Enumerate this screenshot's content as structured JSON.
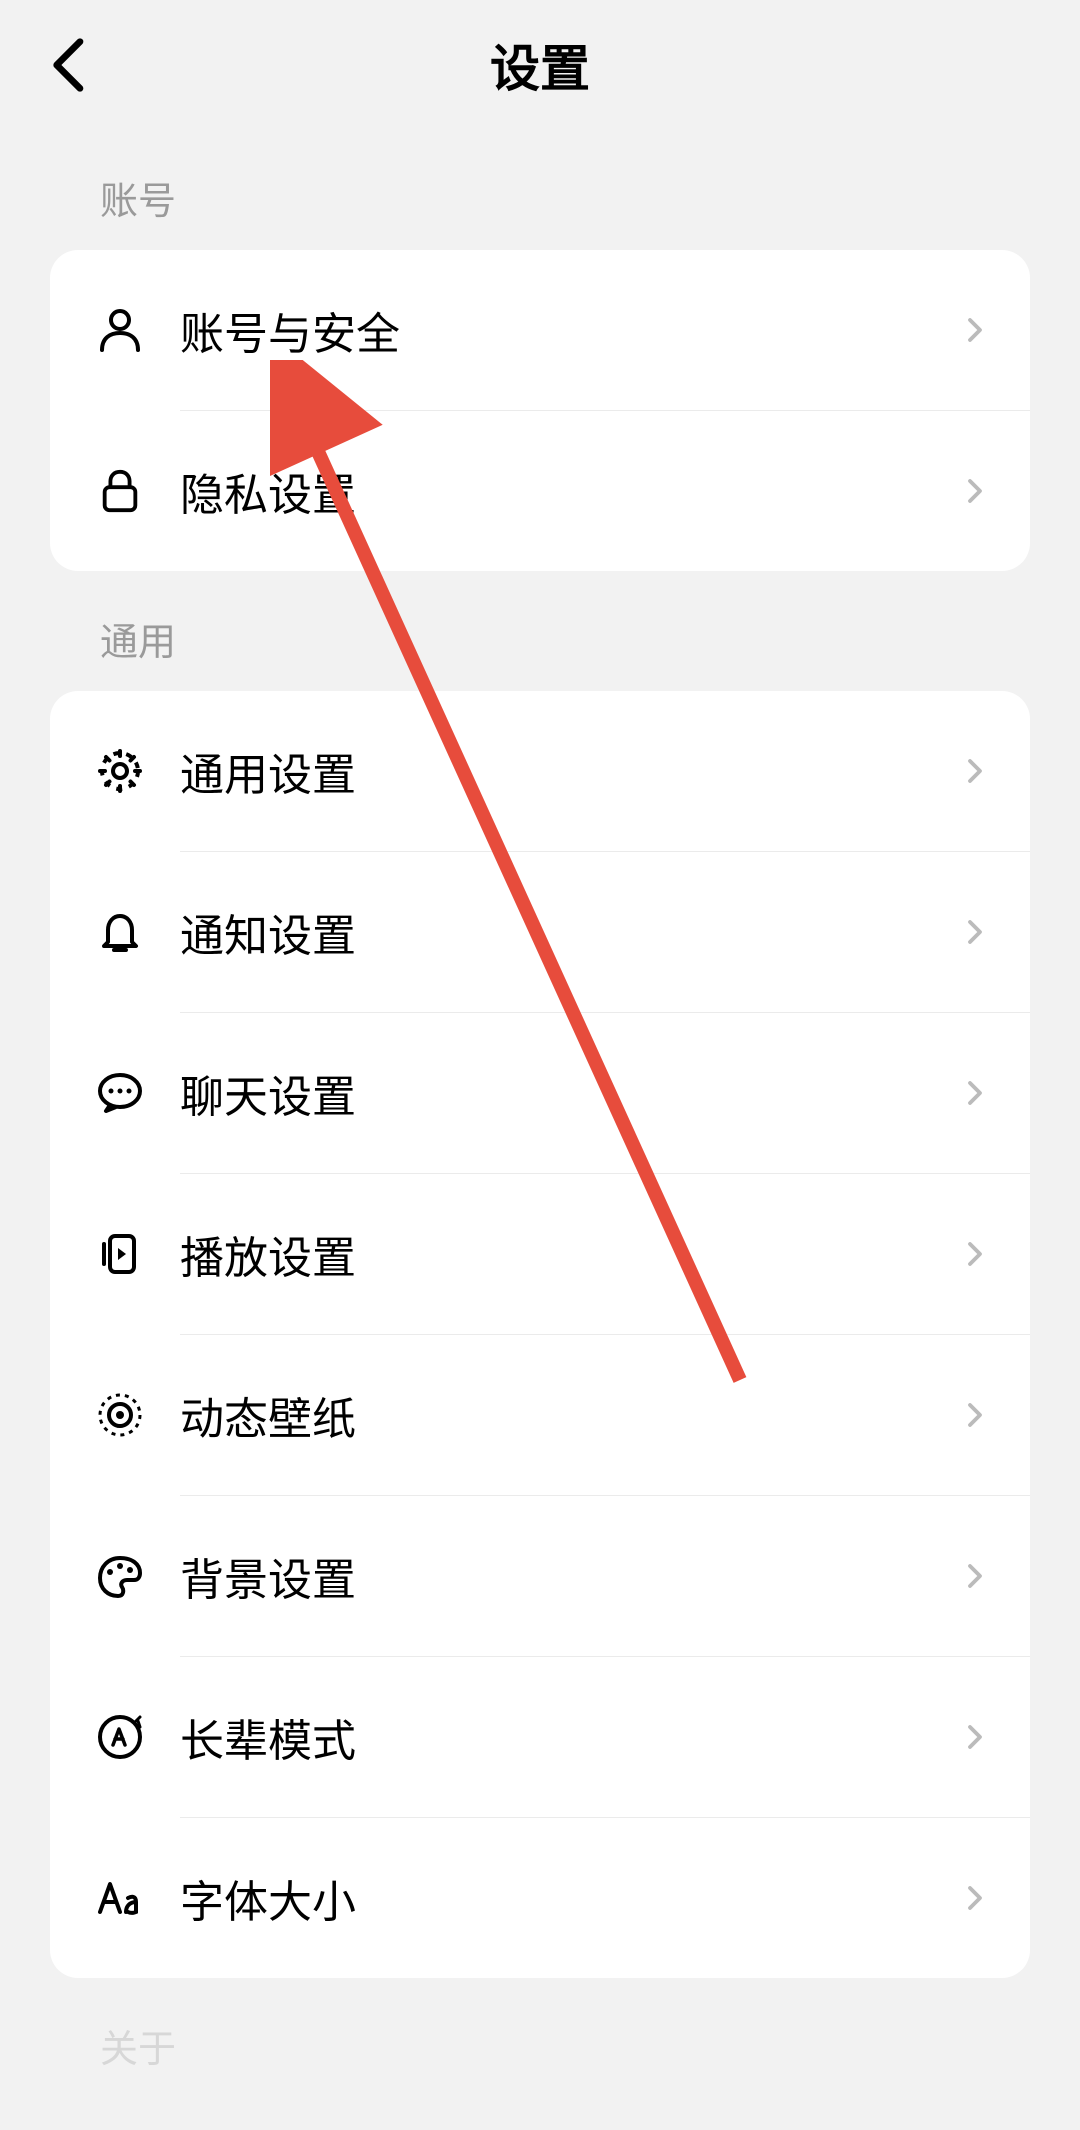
{
  "header": {
    "title": "设置"
  },
  "sections": [
    {
      "header": "账号",
      "items": [
        {
          "id": "account-security",
          "label": "账号与安全",
          "icon": "person-icon"
        },
        {
          "id": "privacy",
          "label": "隐私设置",
          "icon": "lock-icon"
        }
      ]
    },
    {
      "header": "通用",
      "items": [
        {
          "id": "general",
          "label": "通用设置",
          "icon": "gear-icon"
        },
        {
          "id": "notification",
          "label": "通知设置",
          "icon": "bell-icon"
        },
        {
          "id": "chat",
          "label": "聊天设置",
          "icon": "chat-icon"
        },
        {
          "id": "playback",
          "label": "播放设置",
          "icon": "playback-icon"
        },
        {
          "id": "live-wallpaper",
          "label": "动态壁纸",
          "icon": "live-wallpaper-icon"
        },
        {
          "id": "background",
          "label": "背景设置",
          "icon": "palette-icon"
        },
        {
          "id": "elder-mode",
          "label": "长辈模式",
          "icon": "elder-icon"
        },
        {
          "id": "font-size",
          "label": "字体大小",
          "icon": "font-icon"
        }
      ]
    },
    {
      "header": "关于",
      "items": []
    }
  ],
  "annotation": {
    "type": "arrow",
    "color": "#e74c3c",
    "target": "account-security"
  }
}
